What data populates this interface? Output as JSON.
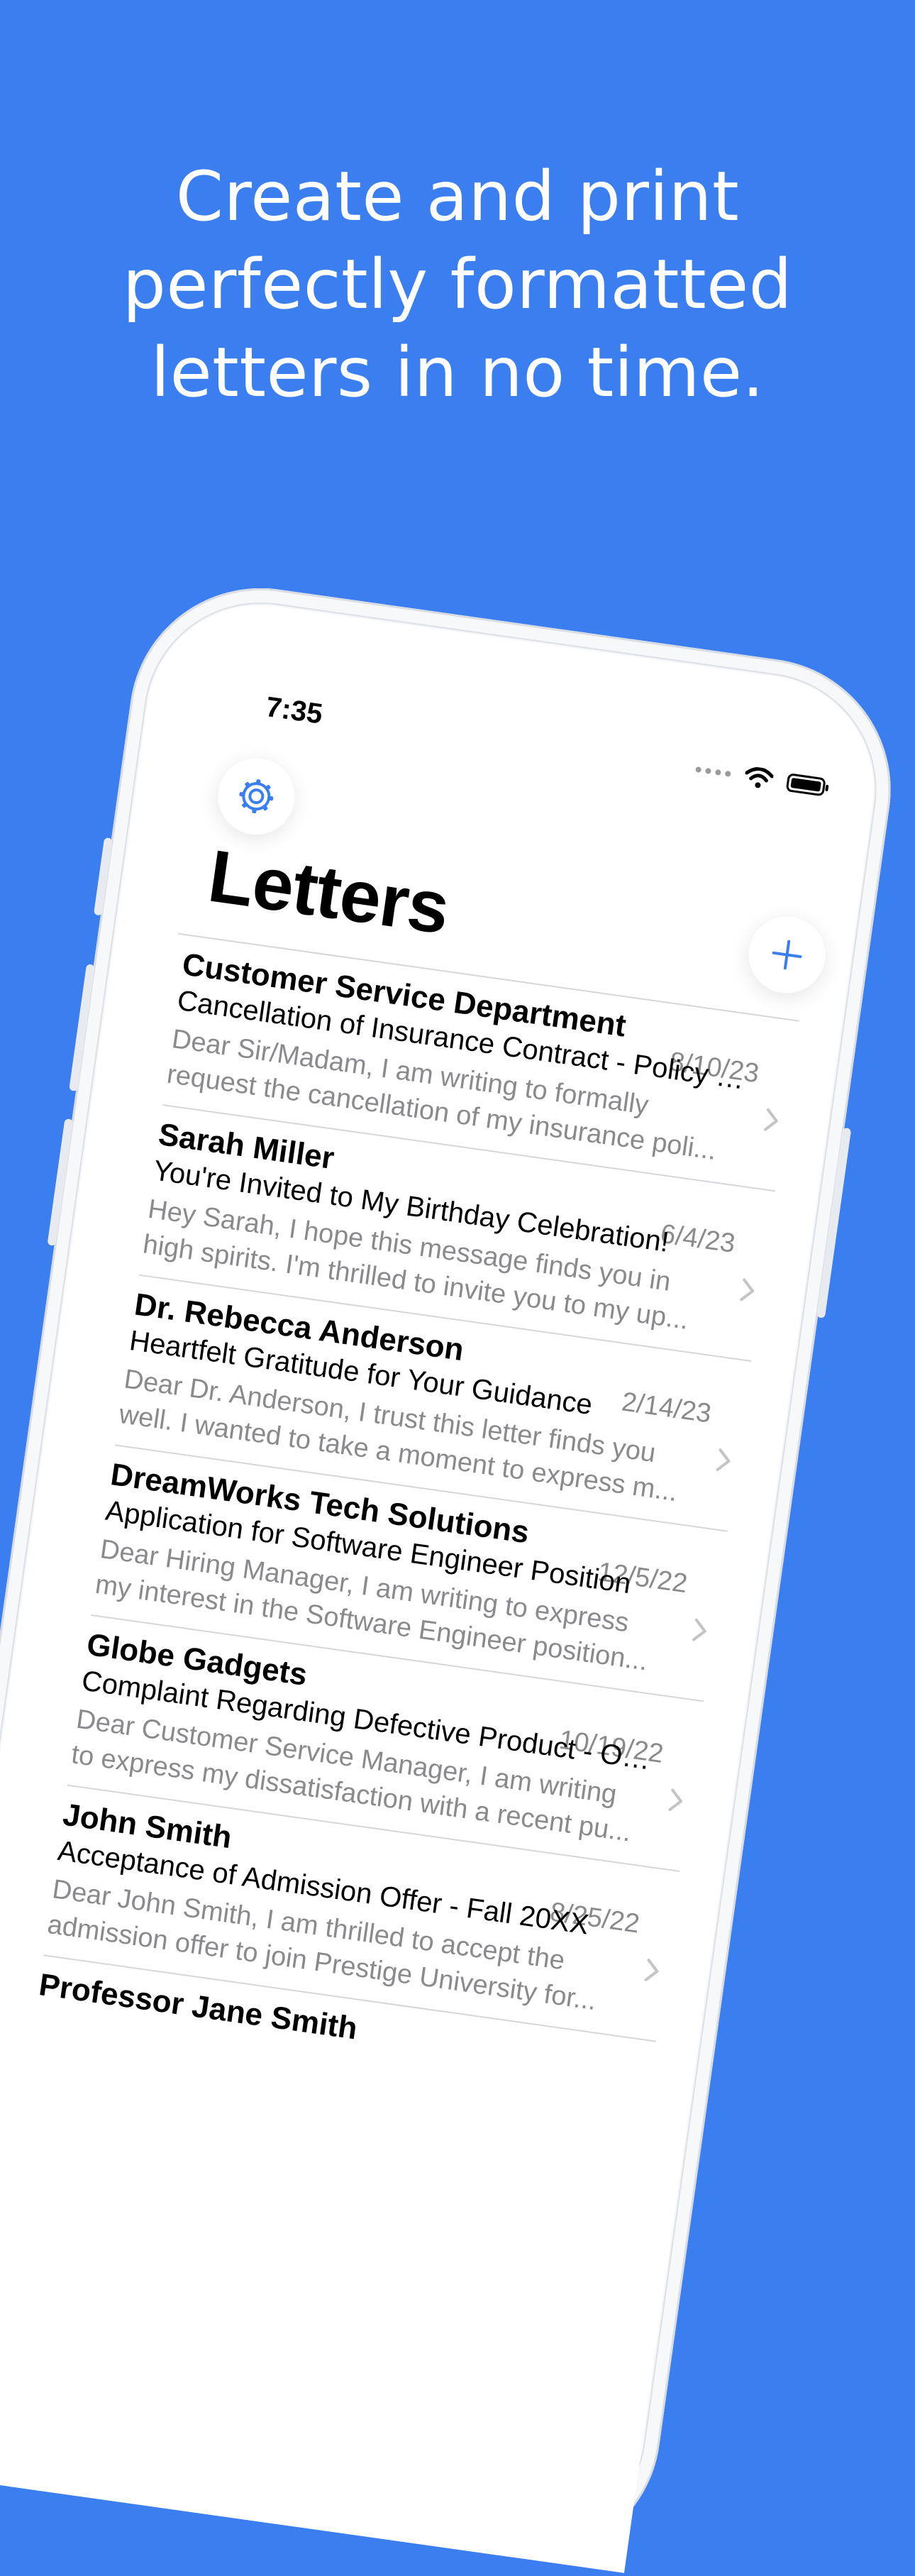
{
  "headline": [
    "Create and print",
    "perfectly formatted",
    "letters in no time."
  ],
  "status_bar": {
    "time": "7:35"
  },
  "nav": {
    "title": "Letters"
  },
  "colors": {
    "background": "#3a7ef0",
    "accent": "#3a7ef0"
  },
  "icons": {
    "settings": "gear-icon",
    "add": "plus-icon",
    "row": "chevron-right-icon",
    "wifi": "wifi-icon",
    "battery": "battery-icon"
  },
  "letters": [
    {
      "recipient": "Customer Service Department",
      "subject": "Cancellation of Insurance Contract - Policy N...",
      "date": "8/10/23",
      "preview": [
        "Dear Sir/Madam,  I am writing to formally",
        "request the cancellation of my insurance poli..."
      ]
    },
    {
      "recipient": "Sarah Miller",
      "subject": "You're Invited to My Birthday Celebration!",
      "date": "6/4/23",
      "preview": [
        "Hey Sarah,  I hope this message finds you in",
        "high spirits. I'm thrilled to invite you to my up..."
      ]
    },
    {
      "recipient": "Dr. Rebecca Anderson",
      "subject": "Heartfelt Gratitude for Your Guidance",
      "date": "2/14/23",
      "preview": [
        "Dear Dr. Anderson,  I trust this letter finds you",
        "well. I wanted to take a moment to express m..."
      ]
    },
    {
      "recipient": "DreamWorks Tech Solutions",
      "subject": "Application for Software Engineer Position",
      "date": "12/5/22",
      "preview": [
        "Dear Hiring Manager,  I am writing to express",
        "my interest in the Software Engineer position..."
      ]
    },
    {
      "recipient": "Globe Gadgets",
      "subject": "Complaint Regarding Defective Product - Ord...",
      "date": "10/19/22",
      "preview": [
        "Dear Customer Service Manager,  I am writing",
        "to express my dissatisfaction with a recent pu..."
      ]
    },
    {
      "recipient": "John Smith",
      "subject": "Acceptance of Admission Offer - Fall 20XX",
      "date": "8/25/22",
      "preview": [
        "Dear John Smith,  I am thrilled to accept the",
        "admission offer to join Prestige University for..."
      ]
    },
    {
      "recipient": "Professor Jane Smith",
      "subject": "",
      "date": "",
      "preview": [
        "",
        ""
      ]
    }
  ]
}
